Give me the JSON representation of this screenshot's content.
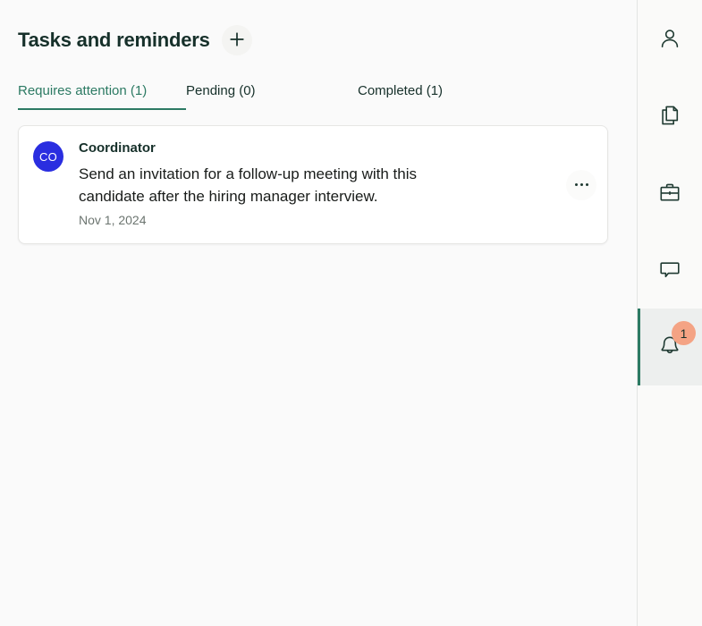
{
  "header": {
    "title": "Tasks and reminders",
    "add_button_label": "+",
    "add_button_icon": "plus-icon"
  },
  "tabs": [
    {
      "label": "Requires attention (1)",
      "name": "requires-attention",
      "active": true
    },
    {
      "label": "Pending (0)",
      "name": "pending",
      "active": false
    },
    {
      "label": "Completed (1)",
      "name": "completed",
      "active": false
    }
  ],
  "tasks": [
    {
      "avatar_initials": "CO",
      "avatar_color": "#2A2EE0",
      "author": "Coordinator",
      "text": "Send an invitation for a follow-up meeting with this candidate after the hiring manager interview.",
      "date": "Nov 1, 2024",
      "menu_icon": "ellipsis-icon"
    }
  ],
  "sidebar": {
    "items": [
      {
        "name": "profile",
        "icon": "person-icon",
        "active": false,
        "badge": null
      },
      {
        "name": "documents",
        "icon": "documents-icon",
        "active": false,
        "badge": null
      },
      {
        "name": "jobs",
        "icon": "briefcase-icon",
        "active": false,
        "badge": null
      },
      {
        "name": "messages",
        "icon": "chat-bubble-icon",
        "active": false,
        "badge": null
      },
      {
        "name": "notifications",
        "icon": "bell-icon",
        "active": true,
        "badge": "1"
      }
    ]
  },
  "colors": {
    "accent_green": "#2C7A63",
    "text_dark": "#16302A",
    "badge_orange": "#F4A384",
    "avatar_blue": "#2A2EE0",
    "page_background": "#FAFAFA"
  }
}
